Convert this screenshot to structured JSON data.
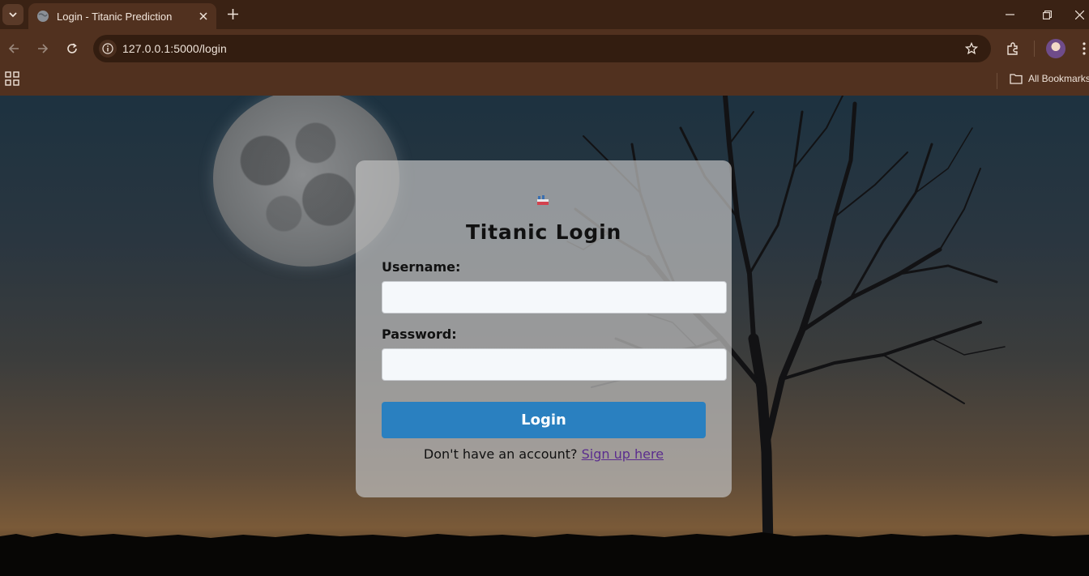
{
  "browser": {
    "tab_title": "Login - Titanic Prediction",
    "url": "127.0.0.1:5000/login",
    "bookmarks_label": "All Bookmarks"
  },
  "login": {
    "title": "Titanic Login",
    "username_label": "Username:",
    "username_value": "",
    "password_label": "Password:",
    "password_value": "",
    "login_button": "Login",
    "signup_prompt": "Don't have an account?",
    "signup_link": "Sign up here"
  },
  "colors": {
    "button": "#2a80c0",
    "link": "#5b2d8e",
    "browser_frame": "#51311f"
  },
  "icons": [
    "tab-search-icon",
    "globe-icon",
    "close-icon",
    "plus-icon",
    "back-icon",
    "forward-icon",
    "reload-icon",
    "info-icon",
    "star-icon",
    "extensions-icon",
    "apps-grid-icon",
    "folder-icon",
    "ship-logo-icon"
  ]
}
